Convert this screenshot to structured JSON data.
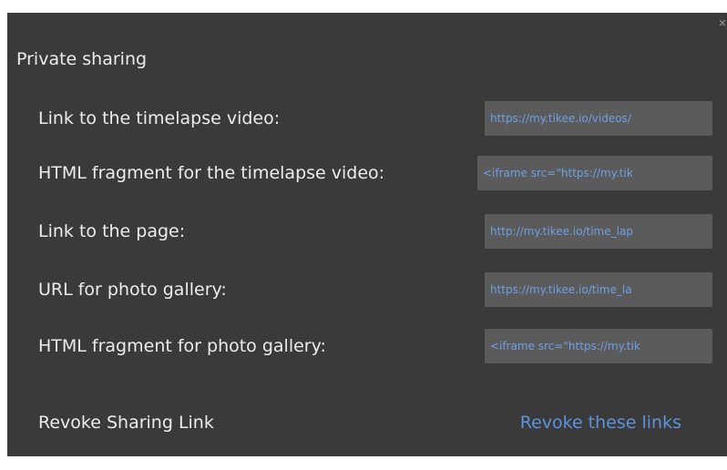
{
  "dialog": {
    "title": "Private sharing",
    "close_glyph": "×"
  },
  "rows": [
    {
      "label": "Link to the timelapse video:",
      "value": "https://my.tikee.io/videos/"
    },
    {
      "label": "HTML fragment for the timelapse video:",
      "value": "<iframe src=\"https://my.tik"
    },
    {
      "label": "Link to the page:",
      "value": "http://my.tikee.io/time_lap"
    },
    {
      "label": "URL for photo gallery:",
      "value": "https://my.tikee.io/time_la"
    },
    {
      "label": "HTML fragment for photo gallery:",
      "value": "<iframe src=\"https://my.tik"
    }
  ],
  "revoke": {
    "label": "Revoke Sharing Link",
    "link_text": "Revoke these links"
  },
  "colors": {
    "panel_bg": "#3a3a3a",
    "field_bg": "#5b5b5b",
    "link": "#5c93dc",
    "text": "#ececec"
  }
}
